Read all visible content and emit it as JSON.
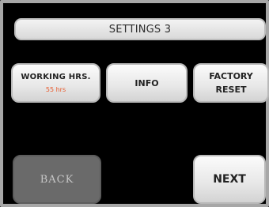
{
  "header": {
    "title": "SETTINGS 3"
  },
  "buttons": {
    "working_hours_label": "WORKING HRS.",
    "working_hours_value": "55 hrs",
    "info": "INFO",
    "factory_line1": "FACTORY",
    "factory_line2": "RESET",
    "back": "BACK",
    "next": "NEXT"
  },
  "colors": {
    "hours_value": "#e85a2c",
    "back_disabled": "#6a6a6a"
  }
}
